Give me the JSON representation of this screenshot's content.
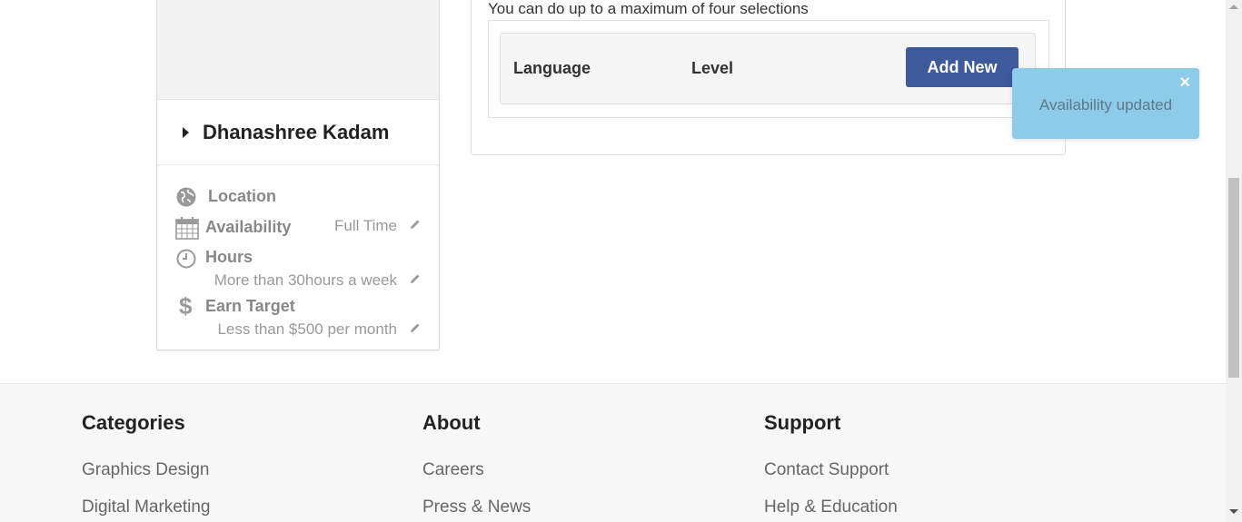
{
  "profile": {
    "name": "Dhanashree Kadam",
    "location_label": "Location",
    "availability_label": "Availability",
    "availability_value": "Full Time",
    "hours_label": "Hours",
    "hours_value": "More than 30hours a week",
    "earn_label": "Earn Target",
    "earn_value": "Less than $500 per month"
  },
  "languages": {
    "note": "You can do up to a maximum of four selections",
    "col_language": "Language",
    "col_level": "Level",
    "add_button": "Add New"
  },
  "toast": {
    "message": "Availability updated",
    "close": "×"
  },
  "footer": {
    "columns": [
      {
        "heading": "Categories",
        "links": [
          "Graphics Design",
          "Digital Marketing"
        ]
      },
      {
        "heading": "About",
        "links": [
          "Careers",
          "Press & News"
        ]
      },
      {
        "heading": "Support",
        "links": [
          "Contact Support",
          "Help & Education"
        ]
      }
    ]
  },
  "colors": {
    "accent_button": "#3d5a9b",
    "toast_bg": "#8ecbe8"
  }
}
